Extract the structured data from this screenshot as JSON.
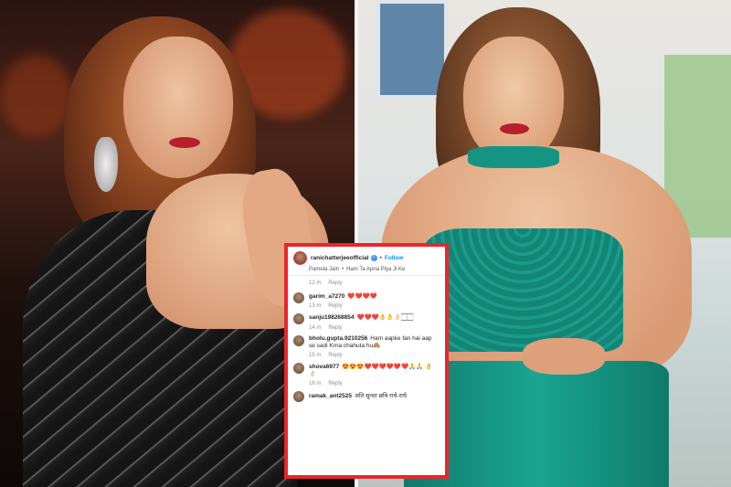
{
  "post": {
    "username": "ranichatterjeeofficial",
    "verified_icon": "verified-badge-icon",
    "separator": "•",
    "follow_label": "Follow",
    "song_artist": "Pamela Jain",
    "song_title": "Ham Ta Apna Piya Ji Ke"
  },
  "first_meta": {
    "time": "12 m",
    "reply": "Reply"
  },
  "comments": [
    {
      "user": "garim_a7270",
      "text": "❤️❤️❤️❤️",
      "time": "13 m",
      "reply": "Reply"
    },
    {
      "user": "sanju198268854",
      "text": "❤️❤️❤️👌👌👌🏻🏻🏻",
      "time": "14 m",
      "reply": "Reply"
    },
    {
      "user": "bholu.gupta.9210256",
      "text": "Ham aapke fan hai aap se sadi Krna chahuta hu🙈",
      "time": "15 m",
      "reply": "Reply"
    },
    {
      "user": "shova6977",
      "text": "😍😍😍❤️❤️❤️❤️❤️❤️🙏🙏 👌👌🏻",
      "time": "18 m",
      "reply": "Reply"
    },
    {
      "user": "ramak_ant2525",
      "text": "अति सुन्दर छवि राधे-राधे",
      "time": "",
      "reply": ""
    }
  ],
  "colors": {
    "card_border": "#e8262b",
    "follow": "#0095f6",
    "teal_outfit": "#169483"
  }
}
